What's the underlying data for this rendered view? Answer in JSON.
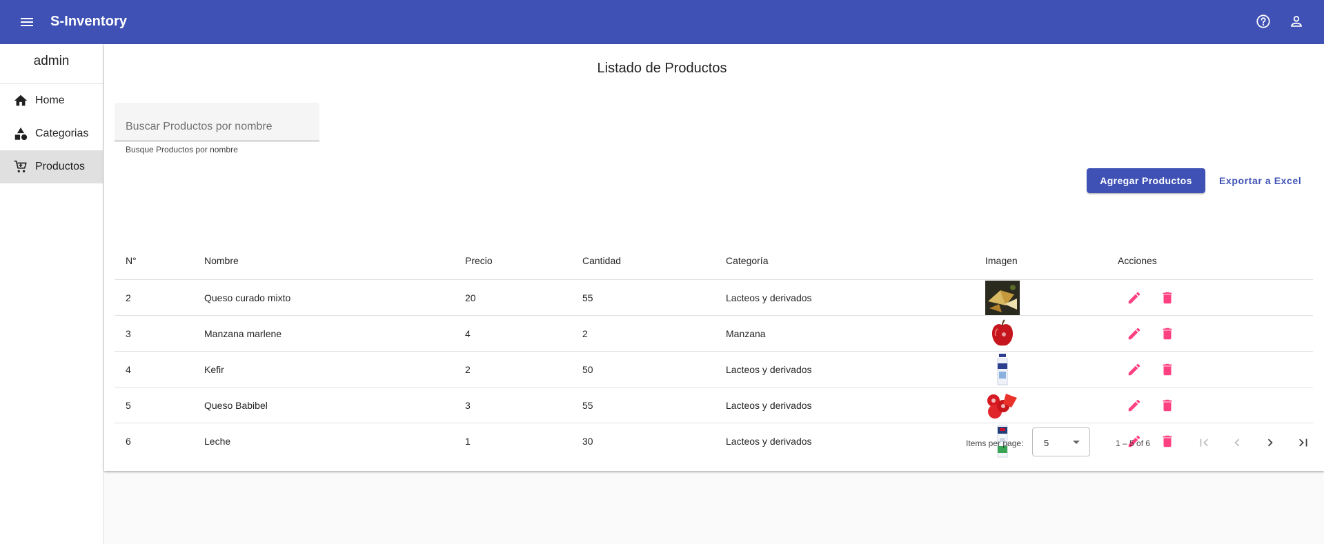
{
  "app": {
    "title": "S-Inventory"
  },
  "toolbar": {
    "icons": [
      "menu-icon",
      "help-icon",
      "account-icon"
    ]
  },
  "sidebar": {
    "user": "admin",
    "items": [
      {
        "label": "Home",
        "icon": "home-icon",
        "active": false
      },
      {
        "label": "Categorias",
        "icon": "category-icon",
        "active": false
      },
      {
        "label": "Productos",
        "icon": "cart-icon",
        "active": true
      }
    ]
  },
  "main": {
    "title": "Listado de Productos",
    "search": {
      "placeholder": "Buscar Productos por nombre",
      "value": "",
      "hint": "Busque Productos por nombre"
    },
    "add_button": "Agregar Productos",
    "export_button": "Exportar a Excel"
  },
  "table": {
    "headers": {
      "num": "N°",
      "name": "Nombre",
      "price": "Precio",
      "qty": "Cantidad",
      "category": "Categoría",
      "image": "Imagen",
      "actions": "Acciones"
    },
    "rows": [
      {
        "num": "2",
        "name": "Queso curado mixto",
        "price": "20",
        "qty": "55",
        "category": "Lacteos y derivados",
        "image": "cheese-wedges-photo"
      },
      {
        "num": "3",
        "name": "Manzana marlene",
        "price": "4",
        "qty": "2",
        "category": "Manzana",
        "image": "red-apple-photo"
      },
      {
        "num": "4",
        "name": "Kefir",
        "price": "2",
        "qty": "50",
        "category": "Lacteos y derivados",
        "image": "kefir-bottle-photo"
      },
      {
        "num": "5",
        "name": "Queso Babibel",
        "price": "3",
        "qty": "55",
        "category": "Lacteos y derivados",
        "image": "babybel-cheese-photo"
      },
      {
        "num": "6",
        "name": "Leche",
        "price": "1",
        "qty": "30",
        "category": "Lacteos y derivados",
        "image": "milk-carton-photo"
      }
    ]
  },
  "paginator": {
    "label": "Items per page:",
    "page_size": "5",
    "range": "1 – 5 of 6"
  },
  "colors": {
    "primary": "#3f51b5",
    "accent": "#ff4081"
  }
}
